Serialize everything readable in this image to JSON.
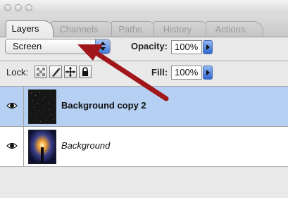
{
  "window": {
    "buttons": [
      "close",
      "minimize",
      "zoom"
    ]
  },
  "tabs": [
    {
      "label": "Layers",
      "active": true
    },
    {
      "label": "Channels",
      "active": false
    },
    {
      "label": "Paths",
      "active": false
    },
    {
      "label": "History",
      "active": false
    },
    {
      "label": "Actions",
      "active": false
    }
  ],
  "controls": {
    "blend_mode": "Screen",
    "opacity_label": "Opacity:",
    "opacity_value": "100%",
    "lock_label": "Lock:",
    "fill_label": "Fill:",
    "fill_value": "100%",
    "lock_icons": [
      "lock-transparent-icon",
      "lock-image-icon",
      "lock-position-icon",
      "lock-all-icon"
    ]
  },
  "layers": [
    {
      "name": "Background copy 2",
      "selected": true,
      "visible": true,
      "style": "bold"
    },
    {
      "name": "Background",
      "selected": false,
      "visible": true,
      "style": "italic"
    }
  ],
  "colors": {
    "selected_row": "#b5d0f3",
    "annotation_arrow": "#a0161a",
    "accent_blue": "#3f77d8"
  }
}
